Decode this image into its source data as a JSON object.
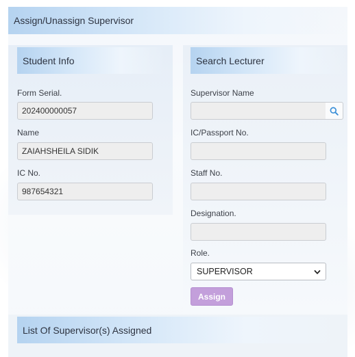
{
  "page": {
    "title": "Assign/Unassign Supervisor"
  },
  "student_info": {
    "heading": "Student Info",
    "form_serial_label": "Form Serial.",
    "form_serial_value": "202400000057",
    "name_label": "Name",
    "name_value": "ZAIAHSHEILA SIDIK",
    "ic_label": "IC No.",
    "ic_value": "987654321"
  },
  "search_lecturer": {
    "heading": "Search Lecturer",
    "supervisor_name_label": "Supervisor Name",
    "supervisor_name_value": "",
    "ic_passport_label": "IC/Passport No.",
    "ic_passport_value": "",
    "staff_no_label": "Staff No.",
    "staff_no_value": "",
    "designation_label": "Designation.",
    "designation_value": "",
    "role_label": "Role.",
    "role_selected": "SUPERVISOR",
    "assign_label": "Assign",
    "search_icon": "search-icon"
  },
  "assigned_list": {
    "heading": "List Of Supervisor(s) Assigned"
  },
  "colors": {
    "header_accent": "#b5d3f0",
    "assign_button": "#c39fdb",
    "search_icon": "#3a8fd8"
  }
}
